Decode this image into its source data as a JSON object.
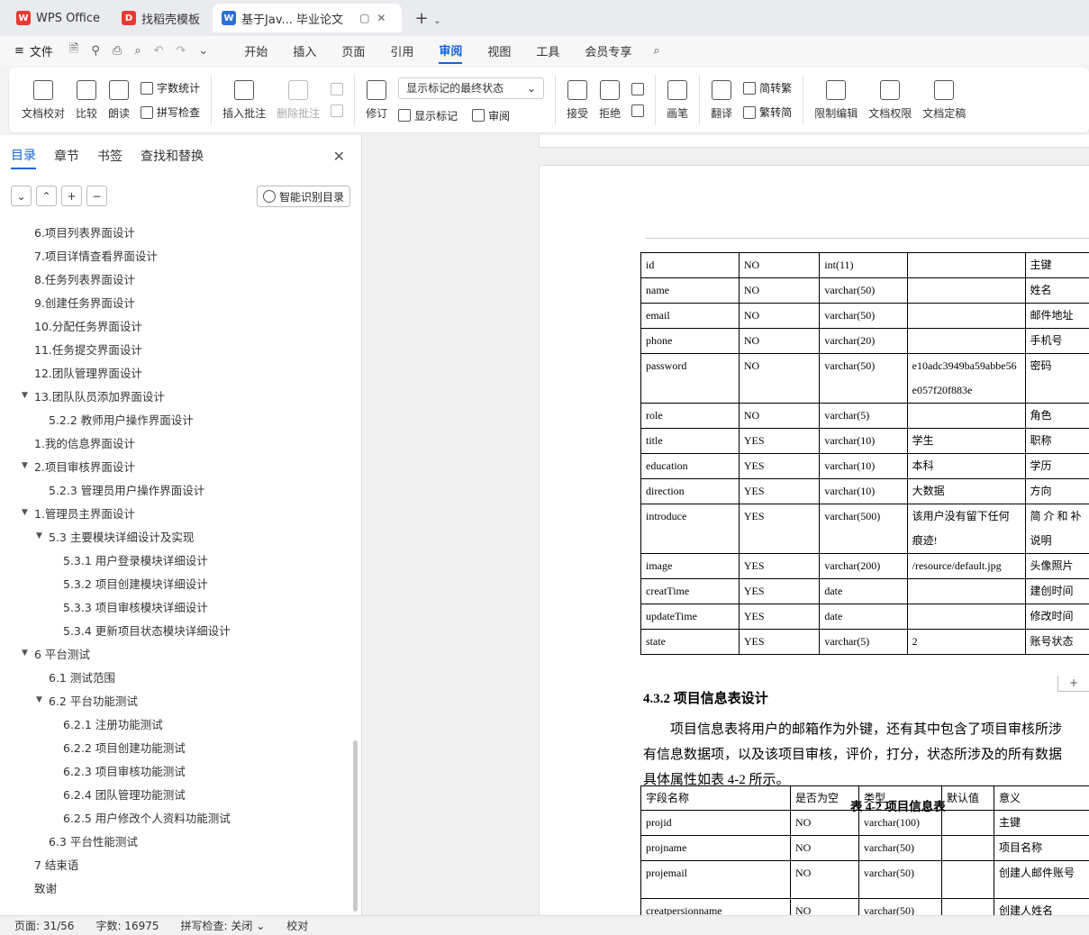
{
  "tabs": [
    {
      "label": "WPS Office",
      "logo": "W",
      "color": "#e83a32"
    },
    {
      "label": "找稻壳模板",
      "logo": "D",
      "color": "#e83a32"
    },
    {
      "label": "基于Jav... 毕业论文",
      "logo": "W",
      "color": "#2b6fde"
    }
  ],
  "menu": {
    "file": "文件",
    "tabs": [
      "开始",
      "插入",
      "页面",
      "引用",
      "审阅",
      "视图",
      "工具",
      "会员专享"
    ],
    "active": "审阅"
  },
  "ribbon": {
    "doc_check": "文档校对",
    "compare": "比较",
    "read_aloud": "朗读",
    "word_count": "字数统计",
    "spell_check": "拼写检查",
    "insert_comment": "插入批注",
    "delete_comment": "删除批注",
    "revise": "修订",
    "markup_state": "显示标记的最终状态",
    "show_markup": "显示标记",
    "review": "审阅",
    "accept": "接受",
    "reject": "拒绝",
    "pen": "画笔",
    "translate": "翻译",
    "to_traditional": "简转繁",
    "to_simplified": "繁转简",
    "restrict_edit": "限制编辑",
    "doc_permission": "文档权限",
    "doc_finalize": "文档定稿"
  },
  "nav": {
    "tabs": [
      "目录",
      "章节",
      "书签",
      "查找和替换"
    ],
    "smart_toc": "智能识别目录",
    "items": [
      {
        "label": "6.项目列表界面设计",
        "level": 0,
        "caret": ""
      },
      {
        "label": "7.项目详情查看界面设计",
        "level": 0,
        "caret": ""
      },
      {
        "label": "8.任务列表界面设计",
        "level": 0,
        "caret": ""
      },
      {
        "label": "9.创建任务界面设计",
        "level": 0,
        "caret": ""
      },
      {
        "label": "10.分配任务界面设计",
        "level": 0,
        "caret": ""
      },
      {
        "label": "11.任务提交界面设计",
        "level": 0,
        "caret": ""
      },
      {
        "label": "12.团队管理界面设计",
        "level": 0,
        "caret": ""
      },
      {
        "label": "13.团队队员添加界面设计",
        "level": 0,
        "caret": "▼"
      },
      {
        "label": "5.2.2  教师用户操作界面设计",
        "level": 1,
        "caret": ""
      },
      {
        "label": "1.我的信息界面设计",
        "level": 0,
        "caret": ""
      },
      {
        "label": "2.项目审核界面设计",
        "level": 0,
        "caret": "▼"
      },
      {
        "label": "5.2.3  管理员用户操作界面设计",
        "level": 1,
        "caret": ""
      },
      {
        "label": "1.管理员主界面设计",
        "level": 0,
        "caret": "▼"
      },
      {
        "label": "5.3  主要模块详细设计及实现",
        "level": 1,
        "caret": "▼"
      },
      {
        "label": "5.3.1  用户登录模块详细设计",
        "level": 2,
        "caret": ""
      },
      {
        "label": "5.3.2  项目创建模块详细设计",
        "level": 2,
        "caret": ""
      },
      {
        "label": "5.3.3  项目审核模块详细设计",
        "level": 2,
        "caret": ""
      },
      {
        "label": "5.3.4  更新项目状态模块详细设计",
        "level": 2,
        "caret": ""
      },
      {
        "label": "6  平台测试",
        "level": 0,
        "caret": "▼"
      },
      {
        "label": "6.1  测试范围",
        "level": 1,
        "caret": ""
      },
      {
        "label": "6.2  平台功能测试",
        "level": 1,
        "caret": "▼"
      },
      {
        "label": "6.2.1  注册功能测试",
        "level": 2,
        "caret": ""
      },
      {
        "label": "6.2.2  项目创建功能测试",
        "level": 2,
        "caret": ""
      },
      {
        "label": "6.2.3  项目审核功能测试",
        "level": 2,
        "caret": ""
      },
      {
        "label": "6.2.4  团队管理功能测试",
        "level": 2,
        "caret": ""
      },
      {
        "label": "6.2.5  用户修改个人资料功能测试",
        "level": 2,
        "caret": ""
      },
      {
        "label": "6.3  平台性能测试",
        "level": 1,
        "caret": ""
      },
      {
        "label": "7  结束语",
        "level": 0,
        "caret": ""
      },
      {
        "label": "致谢",
        "level": 0,
        "caret": ""
      }
    ]
  },
  "doc": {
    "table1": [
      [
        "id",
        "NO",
        "int(11)",
        "",
        "主键"
      ],
      [
        "name",
        "NO",
        "varchar(50)",
        "",
        "姓名"
      ],
      [
        "email",
        "NO",
        "varchar(50)",
        "",
        "邮件地址"
      ],
      [
        "phone",
        "NO",
        "varchar(20)",
        "",
        "手机号"
      ],
      [
        "password",
        "NO",
        "varchar(50)",
        "e10adc3949ba59abbe56\ne057f20f883e",
        "密码"
      ],
      [
        "role",
        "NO",
        "varchar(5)",
        "",
        "角色"
      ],
      [
        "title",
        "YES",
        "varchar(10)",
        "学生",
        "职称"
      ],
      [
        "education",
        "YES",
        "varchar(10)",
        "本科",
        "学历"
      ],
      [
        "direction",
        "YES",
        "varchar(10)",
        "大数据",
        "方向"
      ],
      [
        "introduce",
        "YES",
        "varchar(500)",
        "该用户没有留下任何\n痕迹!",
        "简 介 和 补\n说明"
      ],
      [
        "image",
        "YES",
        "varchar(200)",
        "/resource/default.jpg",
        "头像照片"
      ],
      [
        "creatTime",
        "YES",
        "date",
        "",
        "建创时间"
      ],
      [
        "updateTime",
        "YES",
        "date",
        "",
        "修改时间"
      ],
      [
        "state",
        "YES",
        "varchar(5)",
        "2",
        "账号状态"
      ]
    ],
    "heading": "4.3.2  项目信息表设计",
    "para": [
      "项目信息表将用户的邮箱作为外键，还有其中包含了项目审核所涉",
      "有信息数据项，以及该项目审核，评价，打分，状态所涉及的所有数据",
      "具体属性如表 4-2 所示。"
    ],
    "caption": "表  4-2  项目信息表",
    "table2_header": [
      "字段名称",
      "是否为空",
      "类型",
      "默认值",
      "意义"
    ],
    "table2": [
      [
        "projid",
        "NO",
        "varchar(100)",
        "",
        "主键"
      ],
      [
        "projname",
        "NO",
        "varchar(50)",
        "",
        "项目名称"
      ],
      [
        "projemail",
        "NO",
        "varchar(50)",
        "",
        "创建人邮件账号"
      ],
      [
        "creatpersionname",
        "NO",
        "varchar(50)",
        "",
        "创建人姓名"
      ]
    ]
  },
  "status": {
    "page": "页面: 31/56",
    "words": "字数: 16975",
    "spell": "拼写检查: 关闭",
    "proof": "校对"
  }
}
